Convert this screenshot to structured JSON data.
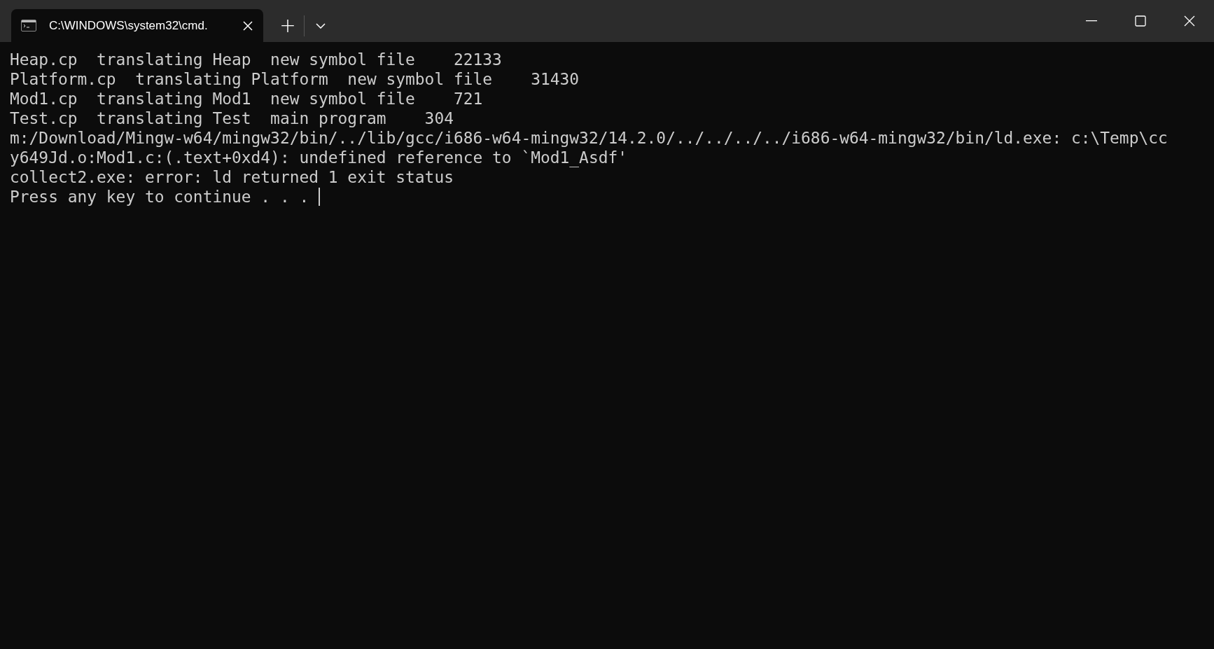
{
  "tabs": [
    {
      "title": "C:\\WINDOWS\\system32\\cmd.",
      "selected": true
    }
  ],
  "new_tab": "+",
  "console": {
    "lines": [
      "Heap.cp  translating Heap  new symbol file    22133",
      "Platform.cp  translating Platform  new symbol file    31430",
      "Mod1.cp  translating Mod1  new symbol file    721",
      "Test.cp  translating Test  main program    304",
      "m:/Download/Mingw-w64/mingw32/bin/../lib/gcc/i686-w64-mingw32/14.2.0/../../../../i686-w64-mingw32/bin/ld.exe: c:\\Temp\\cc",
      "y649Jd.o:Mod1.c:(.text+0xd4): undefined reference to `Mod1_Asdf'",
      "collect2.exe: error: ld returned 1 exit status",
      "Press any key to continue . . . "
    ],
    "cursor": true
  }
}
